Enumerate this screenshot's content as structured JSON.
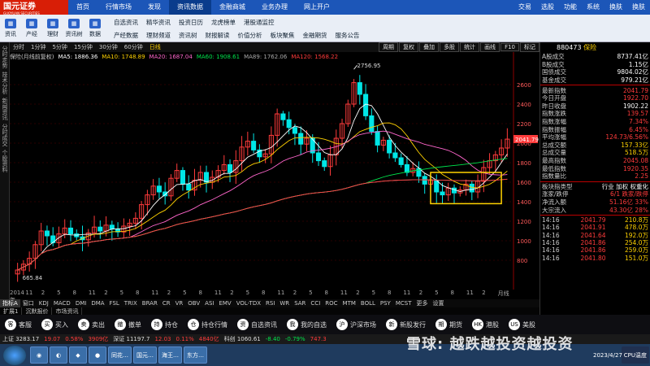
{
  "topbar": {
    "logo": "国元证券",
    "logo_sub": "GUOYUAN SECURITIES",
    "nav": [
      "首页",
      "行情市场",
      "发现",
      "资讯数据",
      "金融商城",
      "业务办理",
      "网上开户"
    ],
    "active_index": 3,
    "right": [
      "交易",
      "选股",
      "功能",
      "系统",
      "换肤",
      "换肤"
    ]
  },
  "toolbar": {
    "icons": [
      "资讯",
      "产经",
      "理财",
      "资讯树",
      "数据"
    ],
    "row1": [
      "自选资讯",
      "精华资讯",
      "投资日历",
      "龙虎榜单",
      "港股通监控"
    ],
    "row2": [
      "产经数据",
      "理财频道",
      "资讯树",
      "财报解读",
      "价值分析",
      "板块聚焦",
      "金融期货",
      "服务公告"
    ]
  },
  "left_strip": [
    "分时走势",
    "技术分析",
    "新闻资讯",
    "分时成交",
    "个股资料"
  ],
  "periodbar": {
    "periods": [
      "分时",
      "1分钟",
      "5分钟",
      "15分钟",
      "30分钟",
      "60分钟",
      "日线"
    ],
    "active": "日线",
    "buttons": [
      "周期",
      "复权",
      "叠加",
      "多股",
      "统计",
      "画线",
      "F10",
      "标记"
    ]
  },
  "ma": {
    "label": "保险(月线前复权)",
    "items": [
      {
        "text": "MA5: 1886.36",
        "color": "#ffffff"
      },
      {
        "text": "MA10: 1748.89",
        "color": "#ffd200"
      },
      {
        "text": "MA20: 1687.04",
        "color": "#ff66cc"
      },
      {
        "text": "MA60: 1908.61",
        "color": "#00e64d"
      },
      {
        "text": "MA89: 1762.06",
        "color": "#aaaaaa"
      },
      {
        "text": "MA120: 1568.22",
        "color": "#ff3b3b"
      }
    ]
  },
  "chart_data": {
    "type": "candlestick",
    "high_label": "2756.95",
    "low_label": "665.84",
    "yticks": [
      2600,
      2400,
      2200,
      2000,
      1800,
      1600,
      1400,
      1200,
      1000,
      800
    ],
    "ylim": [
      600,
      2800
    ],
    "date_labels": [
      "2014年",
      "11",
      "2",
      "5",
      "8",
      "11",
      "2",
      "5",
      "8",
      "11",
      "2",
      "5",
      "8",
      "11",
      "2",
      "5",
      "8",
      "11",
      "2",
      "5",
      "8",
      "11",
      "2",
      "5",
      "8",
      "11",
      "2",
      "5",
      "8",
      "11",
      "2",
      "月线"
    ],
    "last_price": "2041.79",
    "closes": [
      700,
      760,
      820,
      960,
      1100,
      1050,
      980,
      1070,
      1130,
      1070,
      1040,
      1010,
      1080,
      1140,
      1100,
      1160,
      1120,
      1090,
      1150,
      1180,
      1230,
      1370,
      1470,
      1560,
      1500,
      1460,
      1640,
      1720,
      1580,
      1520,
      1620,
      1700,
      1600,
      1650,
      1720,
      1780,
      1700,
      1820,
      1960,
      2020,
      1930,
      1860,
      1890,
      2080,
      2300,
      2240,
      2160,
      2100,
      1990,
      2050,
      1900,
      1820,
      1760,
      1880,
      2050,
      2200,
      2400,
      2620,
      2500,
      2280,
      2120,
      1980,
      2030,
      1900,
      1850,
      1780,
      1700,
      1740,
      1660,
      1580,
      1620,
      1500,
      1470,
      1540,
      1490,
      1520,
      1580,
      1500,
      1610,
      1750,
      1820,
      1880,
      1950,
      2041
    ]
  },
  "right_panel": {
    "code": "880473",
    "name": "保险",
    "rows1": [
      {
        "k": "A股成交",
        "v": "8737.41亿",
        "c": "wht"
      },
      {
        "k": "B股成交",
        "v": "1.15亿",
        "c": "wht"
      },
      {
        "k": "国债成交",
        "v": "9804.02亿",
        "c": "wht"
      },
      {
        "k": "基金成交",
        "v": "979.21亿",
        "c": "wht"
      }
    ],
    "rows2": [
      {
        "k": "最新指数",
        "v": "2041.79",
        "c": "red"
      },
      {
        "k": "今日开盘",
        "v": "1922.70",
        "c": "red"
      },
      {
        "k": "昨日收盘",
        "v": "1902.22",
        "c": "wht"
      },
      {
        "k": "指数涨跌",
        "v": "139.57",
        "c": "red"
      },
      {
        "k": "指数涨幅",
        "v": "7.34%",
        "c": "red"
      },
      {
        "k": "指数振幅",
        "v": "6.45%",
        "c": "red"
      },
      {
        "k": "平均涨幅",
        "v": "124.73/6.56%",
        "c": "red"
      },
      {
        "k": "总成交额",
        "v": "157.33亿",
        "c": "yel"
      },
      {
        "k": "总成交量",
        "v": "518.5万",
        "c": "yel"
      },
      {
        "k": "最高指数",
        "v": "2045.08",
        "c": "red"
      },
      {
        "k": "最低指数",
        "v": "1920.35",
        "c": "red"
      },
      {
        "k": "指数量比",
        "v": "2.25",
        "c": "red"
      }
    ],
    "rows3": [
      {
        "k": "板块指类型",
        "v": "行业 加权 权重化",
        "c": "wht"
      },
      {
        "k": "涨家/跌停",
        "v": "6/1 跌家/跌停",
        "c": "red"
      },
      {
        "k": "净流入额",
        "v": "51.16亿 33%",
        "c": "red"
      },
      {
        "k": "大宗流入",
        "v": "43.30亿 28%",
        "c": "red"
      }
    ],
    "ticks": [
      [
        "14:16",
        "2041.79",
        "210.8万"
      ],
      [
        "14:16",
        "2041.91",
        "478.0万"
      ],
      [
        "14:16",
        "2041.64",
        "192.0万"
      ],
      [
        "14:16",
        "2041.86",
        "254.0万"
      ],
      [
        "14:16",
        "2041.86",
        "259.0万"
      ],
      [
        "14:16",
        "2041.80",
        "151.0万"
      ]
    ]
  },
  "indicators": [
    "指标A",
    "窗口",
    "KDJ",
    "MACD",
    "DMI",
    "DMA",
    "FSL",
    "TRIX",
    "BRAR",
    "CR",
    "VR",
    "OBV",
    "ASI",
    "EMV",
    "VOL-TDX",
    "RSI",
    "WR",
    "SAR",
    "CCI",
    "ROC",
    "MTM",
    "BOLL",
    "PSY",
    "MCST",
    "更多",
    "设置"
  ],
  "subtabs": [
    "扩展1",
    "沉默报价",
    "市场资讯"
  ],
  "bottomnav": [
    {
      "icon": "客",
      "label": "客服"
    },
    {
      "icon": "买",
      "label": "买入"
    },
    {
      "icon": "卖",
      "label": "卖出"
    },
    {
      "icon": "撤",
      "label": "撤单"
    },
    {
      "icon": "持",
      "label": "持仓"
    },
    {
      "icon": "仓",
      "label": "持仓行情"
    },
    {
      "icon": "资",
      "label": "自选资讯"
    },
    {
      "icon": "我",
      "label": "我的自选"
    },
    {
      "icon": "沪",
      "label": "沪深市场"
    },
    {
      "icon": "新",
      "label": "新股发行"
    },
    {
      "icon": "期",
      "label": "期货"
    },
    {
      "icon": "HK",
      "label": "港股"
    },
    {
      "icon": "US",
      "label": "美股"
    }
  ],
  "statusbar": [
    "上证 3283.17",
    "19.07",
    "0.58%",
    "3909亿",
    "深证 11197.7",
    "12.03",
    "0.11%",
    "4840亿",
    "科创 1060.61",
    "-8.40",
    "-0.79%",
    "747.3"
  ],
  "taskbar": {
    "apps": [
      "同花…",
      "国元…",
      "海王…",
      "东方…"
    ],
    "tray": "CPU温度",
    "date": "2023/4/27"
  },
  "watermark": "雪球: 越跌越投资越投资"
}
